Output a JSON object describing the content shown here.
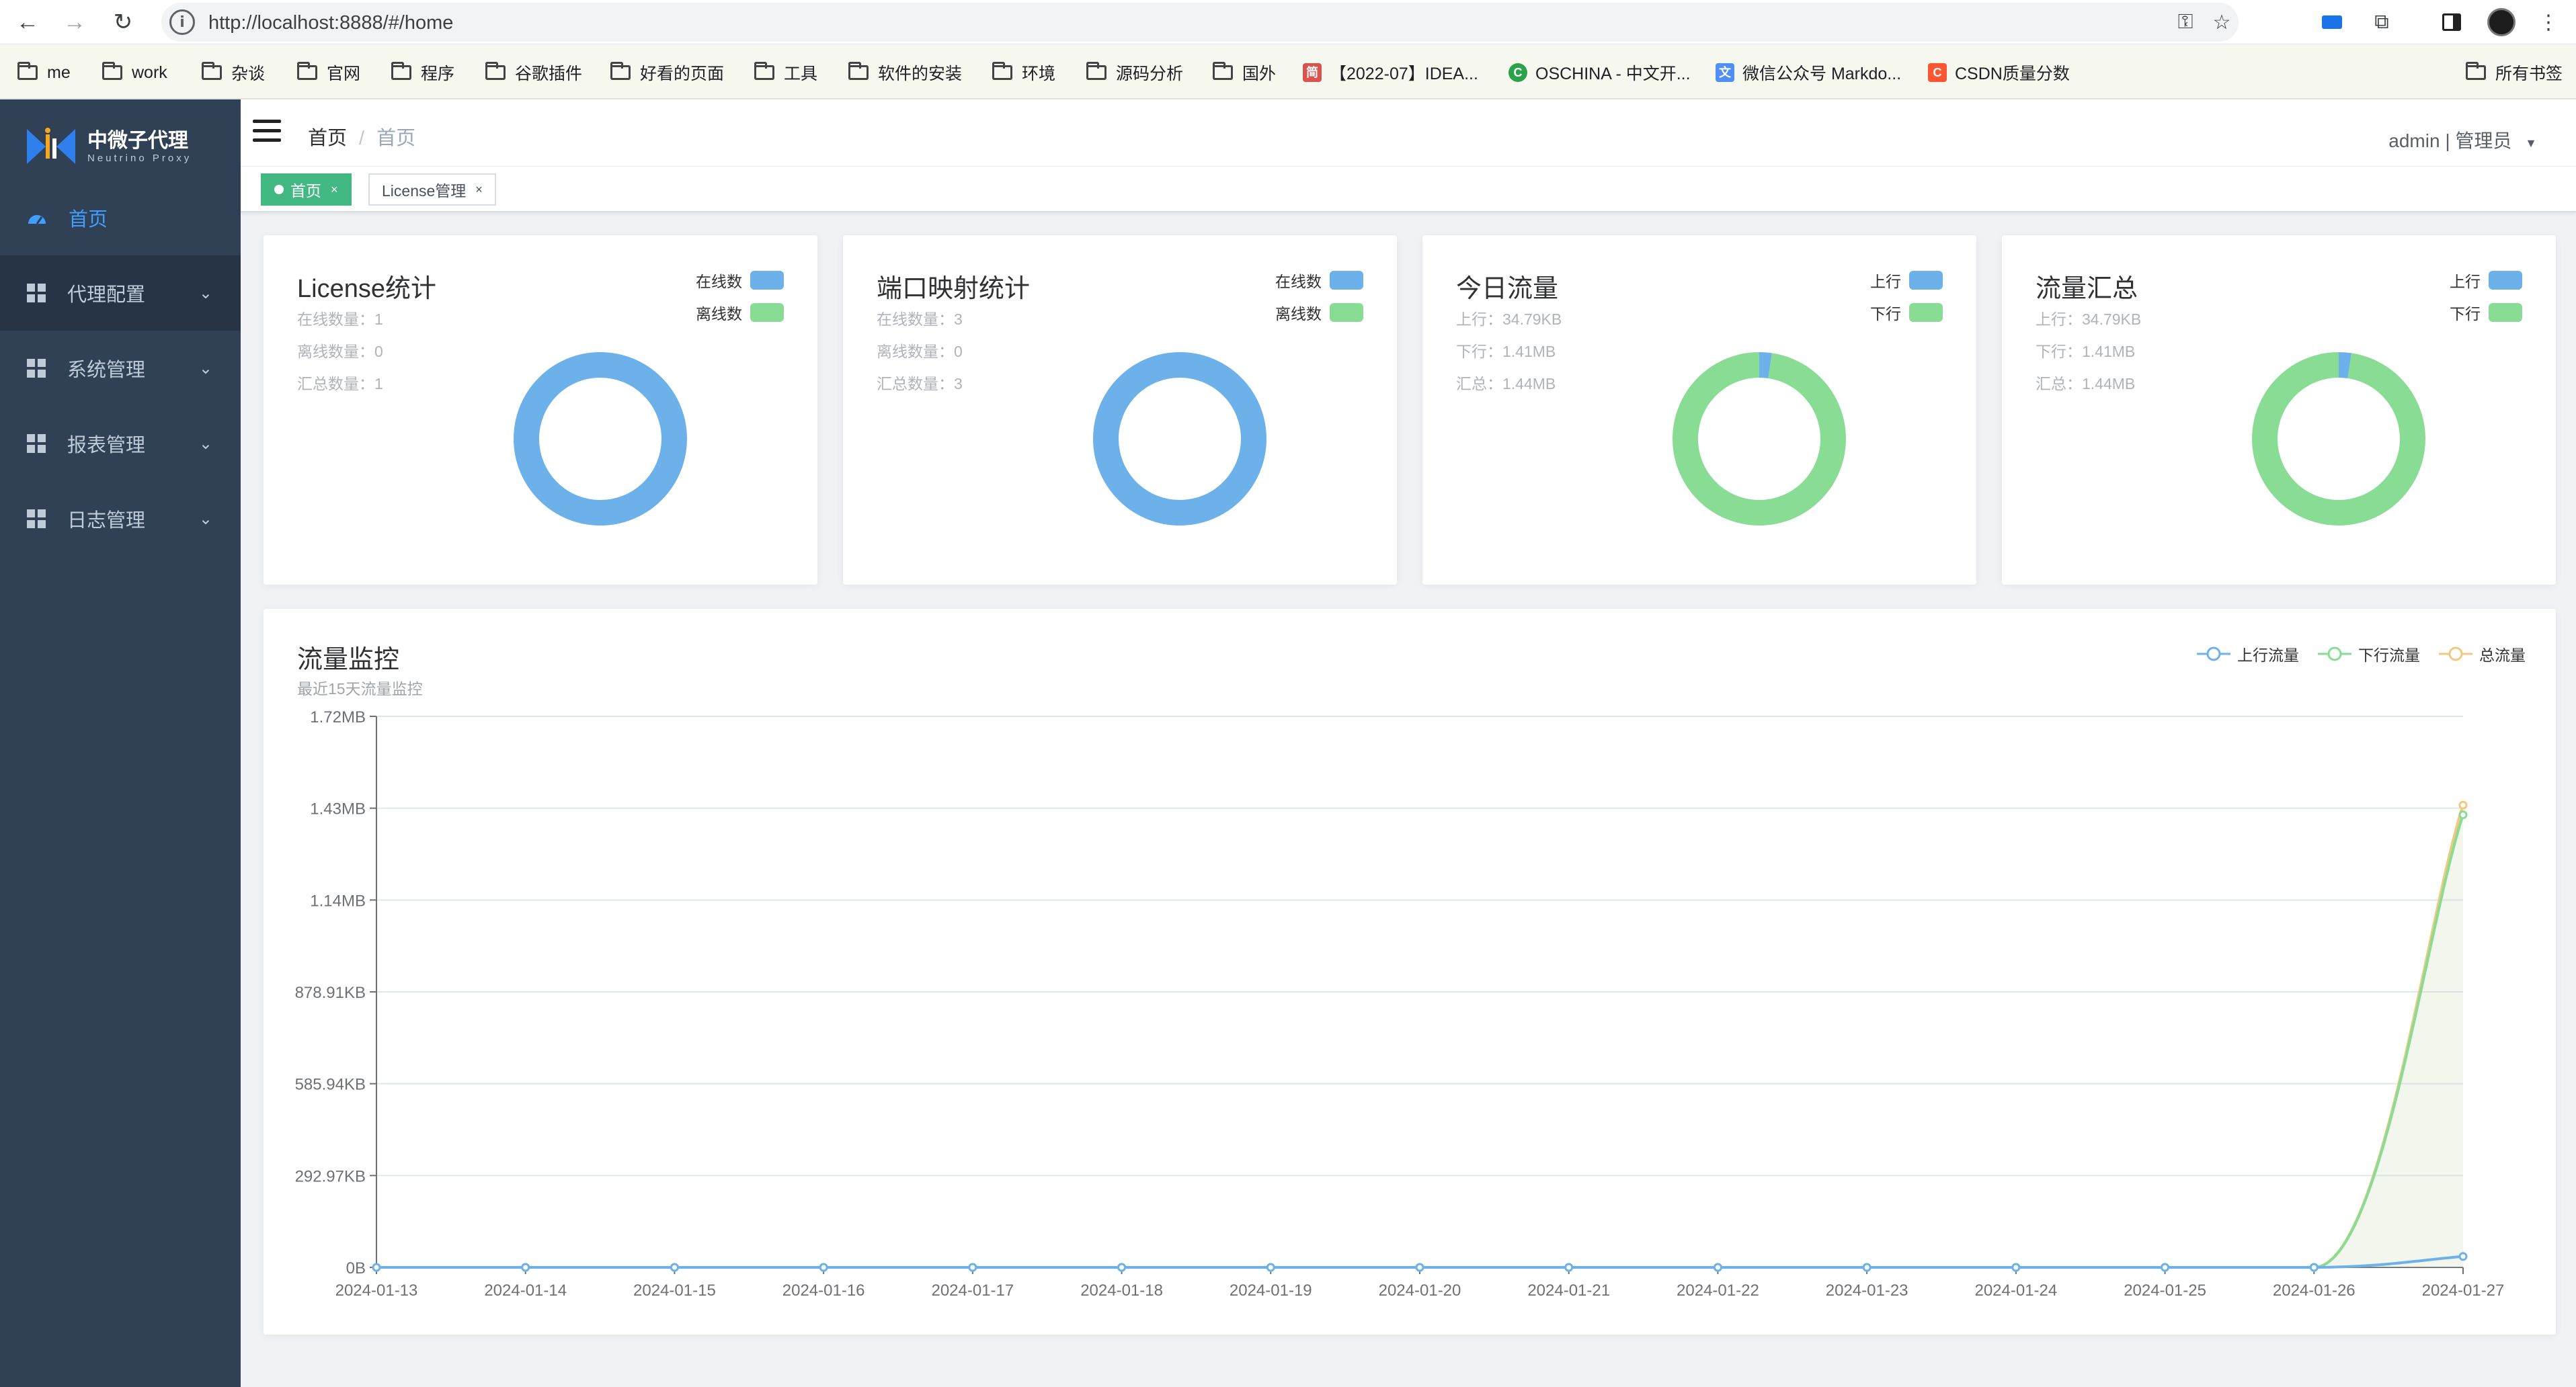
{
  "browser": {
    "url": "http://localhost:8888/#/home",
    "bookmarks": [
      {
        "label": "me",
        "type": "folder"
      },
      {
        "label": "work",
        "type": "folder"
      },
      {
        "label": "杂谈",
        "type": "folder"
      },
      {
        "label": "官网",
        "type": "folder"
      },
      {
        "label": "程序",
        "type": "folder"
      },
      {
        "label": "谷歌插件",
        "type": "folder"
      },
      {
        "label": "好看的页面",
        "type": "folder"
      },
      {
        "label": "工具",
        "type": "folder"
      },
      {
        "label": "软件的安装",
        "type": "folder"
      },
      {
        "label": "环境",
        "type": "folder"
      },
      {
        "label": "源码分析",
        "type": "folder"
      },
      {
        "label": "国外",
        "type": "folder"
      },
      {
        "label": "【2022-07】IDEA...",
        "type": "site"
      },
      {
        "label": "OSCHINA - 中文开...",
        "type": "site"
      },
      {
        "label": "微信公众号 Markdo...",
        "type": "site"
      },
      {
        "label": "CSDN质量分数",
        "type": "site"
      }
    ],
    "all_bookmarks": "所有书签"
  },
  "sidebar": {
    "logo_title": "中微子代理",
    "logo_subtitle": "Neutrino Proxy",
    "items": [
      {
        "label": "首页",
        "active": true
      },
      {
        "label": "代理配置"
      },
      {
        "label": "系统管理"
      },
      {
        "label": "报表管理"
      },
      {
        "label": "日志管理"
      }
    ]
  },
  "header": {
    "breadcrumb": [
      "首页",
      "首页"
    ],
    "user": "admin | 管理员"
  },
  "tags": [
    {
      "label": "首页",
      "active": true,
      "close": "×"
    },
    {
      "label": "License管理",
      "active": false,
      "close": "×"
    }
  ],
  "colors": {
    "blue": "#6cb1ea",
    "green": "#89dc94",
    "orange": "#f3c87e"
  },
  "cards": [
    {
      "title": "License统计",
      "lines": [
        "在线数量：1",
        "离线数量：0",
        "汇总数量：1"
      ],
      "legend": [
        "在线数",
        "离线数"
      ],
      "values": [
        1,
        0
      ]
    },
    {
      "title": "端口映射统计",
      "lines": [
        "在线数量：3",
        "离线数量：0",
        "汇总数量：3"
      ],
      "legend": [
        "在线数",
        "离线数"
      ],
      "values": [
        3,
        0
      ]
    },
    {
      "title": "今日流量",
      "lines": [
        "上行：34.79KB",
        "下行：1.41MB",
        "汇总：1.44MB"
      ],
      "legend": [
        "上行",
        "下行"
      ],
      "values": [
        34.79,
        1443.84
      ]
    },
    {
      "title": "流量汇总",
      "lines": [
        "上行：34.79KB",
        "下行：1.41MB",
        "汇总：1.44MB"
      ],
      "legend": [
        "上行",
        "下行"
      ],
      "values": [
        34.79,
        1443.84
      ]
    }
  ],
  "monitor": {
    "title": "流量监控",
    "subtitle": "最近15天流量监控"
  },
  "chart_data": {
    "type": "line",
    "x": [
      "2024-01-13",
      "2024-01-14",
      "2024-01-15",
      "2024-01-16",
      "2024-01-17",
      "2024-01-18",
      "2024-01-19",
      "2024-01-20",
      "2024-01-21",
      "2024-01-22",
      "2024-01-23",
      "2024-01-24",
      "2024-01-25",
      "2024-01-26",
      "2024-01-27"
    ],
    "yticks": [
      "0B",
      "292.97KB",
      "585.94KB",
      "878.91KB",
      "1.14MB",
      "1.43MB",
      "1.72MB"
    ],
    "ylim_kb": [
      0,
      1757.81
    ],
    "series": [
      {
        "name": "上行流量",
        "color": "#6cb1ea",
        "values_kb": [
          0,
          0,
          0,
          0,
          0,
          0,
          0,
          0,
          0,
          0,
          0,
          0,
          0,
          0,
          34.79
        ]
      },
      {
        "name": "下行流量",
        "color": "#89dc94",
        "values_kb": [
          0,
          0,
          0,
          0,
          0,
          0,
          0,
          0,
          0,
          0,
          0,
          0,
          0,
          0,
          1443.84
        ]
      },
      {
        "name": "总流量",
        "color": "#f3c87e",
        "values_kb": [
          0,
          0,
          0,
          0,
          0,
          0,
          0,
          0,
          0,
          0,
          0,
          0,
          0,
          0,
          1474.56
        ]
      }
    ],
    "grid": true,
    "legend_position": "top-right"
  }
}
